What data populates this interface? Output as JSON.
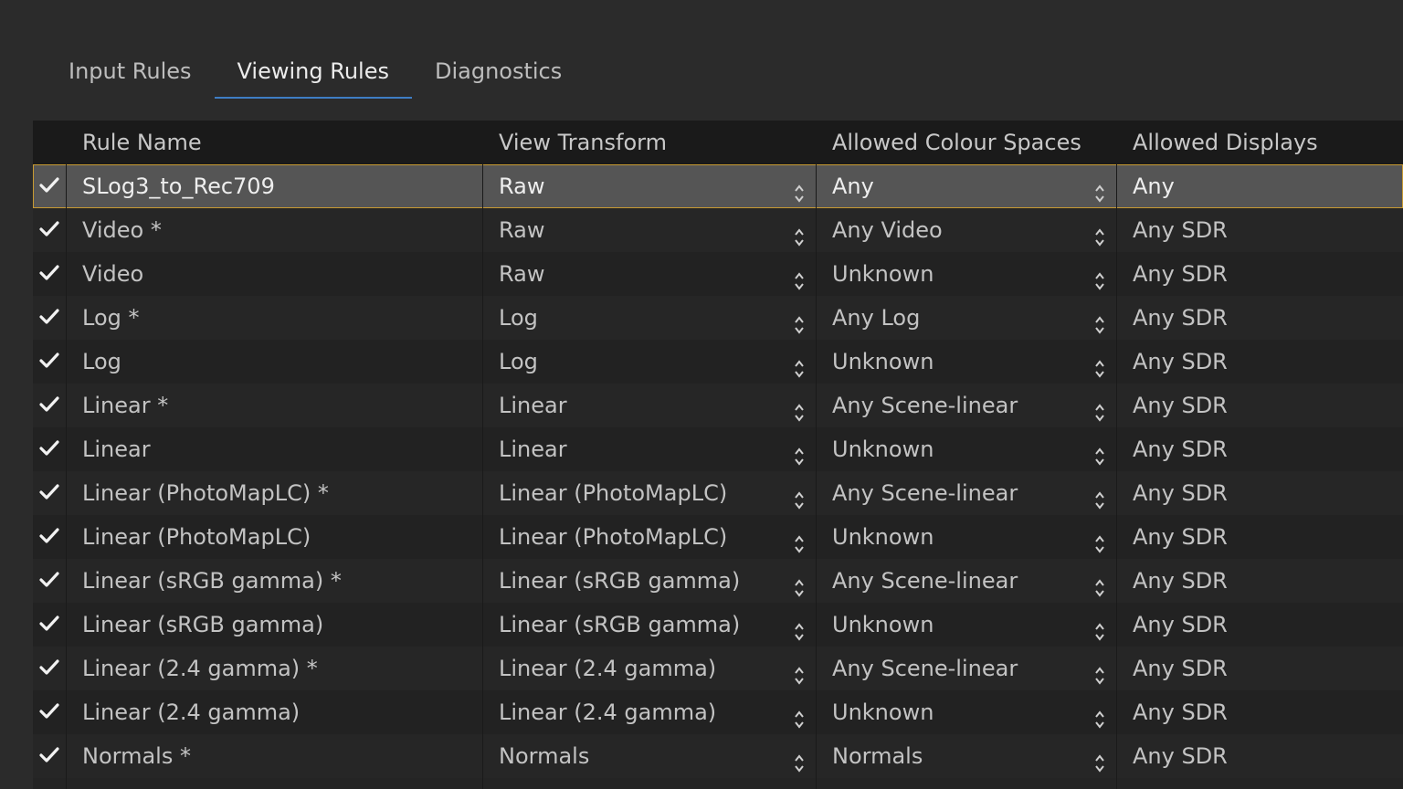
{
  "tabs": [
    {
      "label": "Input Rules",
      "active": false
    },
    {
      "label": "Viewing Rules",
      "active": true
    },
    {
      "label": "Diagnostics",
      "active": false
    }
  ],
  "columns": {
    "name": "Rule Name",
    "view": "View Transform",
    "colour_spaces": "Allowed Colour Spaces",
    "displays": "Allowed Displays"
  },
  "accent_color": "#3e7dc4",
  "selection_outline_color": "#c79a32",
  "rows": [
    {
      "enabled": true,
      "name": "SLog3_to_Rec709",
      "view": "Raw",
      "colour_spaces": "Any",
      "displays": "Any",
      "selected": true
    },
    {
      "enabled": true,
      "name": "Video *",
      "view": "Raw",
      "colour_spaces": "Any Video",
      "displays": "Any SDR"
    },
    {
      "enabled": true,
      "name": "Video",
      "view": "Raw",
      "colour_spaces": "Unknown",
      "displays": "Any SDR"
    },
    {
      "enabled": true,
      "name": "Log *",
      "view": "Log",
      "colour_spaces": "Any Log",
      "displays": "Any SDR"
    },
    {
      "enabled": true,
      "name": "Log",
      "view": "Log",
      "colour_spaces": "Unknown",
      "displays": "Any SDR"
    },
    {
      "enabled": true,
      "name": "Linear *",
      "view": "Linear",
      "colour_spaces": "Any Scene-linear",
      "displays": "Any SDR"
    },
    {
      "enabled": true,
      "name": "Linear",
      "view": "Linear",
      "colour_spaces": "Unknown",
      "displays": "Any SDR"
    },
    {
      "enabled": true,
      "name": "Linear (PhotoMapLC) *",
      "view": "Linear (PhotoMapLC)",
      "colour_spaces": "Any Scene-linear",
      "displays": "Any SDR"
    },
    {
      "enabled": true,
      "name": "Linear (PhotoMapLC)",
      "view": "Linear (PhotoMapLC)",
      "colour_spaces": "Unknown",
      "displays": "Any SDR"
    },
    {
      "enabled": true,
      "name": "Linear (sRGB gamma) *",
      "view": "Linear (sRGB gamma)",
      "colour_spaces": "Any Scene-linear",
      "displays": "Any SDR"
    },
    {
      "enabled": true,
      "name": "Linear (sRGB gamma)",
      "view": "Linear (sRGB gamma)",
      "colour_spaces": "Unknown",
      "displays": "Any SDR"
    },
    {
      "enabled": true,
      "name": "Linear (2.4 gamma) *",
      "view": "Linear (2.4 gamma)",
      "colour_spaces": "Any Scene-linear",
      "displays": "Any SDR"
    },
    {
      "enabled": true,
      "name": "Linear (2.4 gamma)",
      "view": "Linear (2.4 gamma)",
      "colour_spaces": "Unknown",
      "displays": "Any SDR"
    },
    {
      "enabled": true,
      "name": "Normals *",
      "view": "Normals",
      "colour_spaces": "Normals",
      "displays": "Any SDR"
    }
  ]
}
